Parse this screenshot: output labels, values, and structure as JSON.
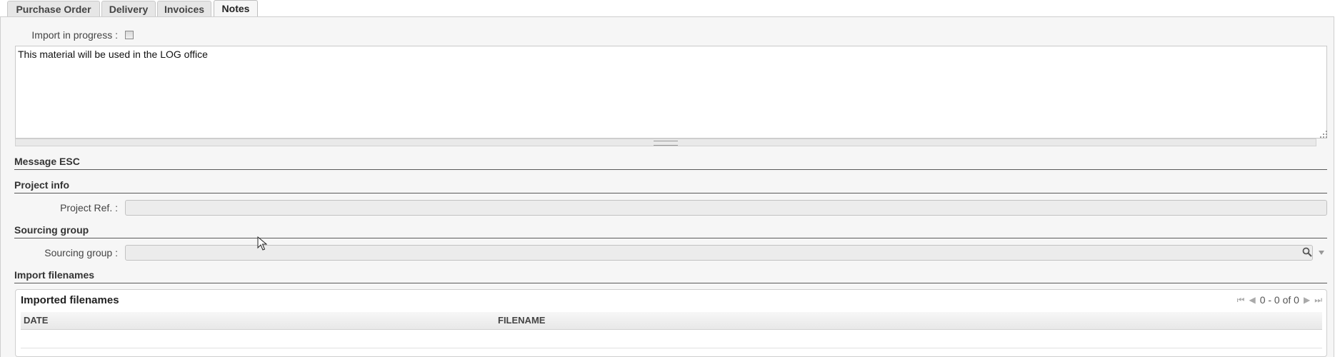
{
  "tabs": [
    {
      "label": "Purchase Order",
      "active": false
    },
    {
      "label": "Delivery",
      "active": false
    },
    {
      "label": "Invoices",
      "active": false
    },
    {
      "label": "Notes",
      "active": true
    }
  ],
  "notes_panel": {
    "import_in_progress_label": "Import in progress :",
    "import_in_progress_checked": false,
    "notes_text": "This material will be used in the LOG office"
  },
  "sections": {
    "message_esc": "Message ESC",
    "project_info": "Project info",
    "sourcing_group": "Sourcing group",
    "import_filenames": "Import filenames"
  },
  "fields": {
    "project_ref_label": "Project Ref. :",
    "project_ref_value": "",
    "sourcing_group_label": "Sourcing group :",
    "sourcing_group_value": ""
  },
  "imported_grid": {
    "title": "Imported filenames",
    "pager_text": "0 - 0 of 0",
    "columns": [
      "DATE",
      "FILENAME"
    ],
    "rows": []
  },
  "icons": {
    "first_page": "first-page-icon",
    "prev_page": "prev-page-icon",
    "next_page": "next-page-icon",
    "last_page": "last-page-icon",
    "search": "search-icon",
    "dropdown": "chevron-down-icon"
  }
}
